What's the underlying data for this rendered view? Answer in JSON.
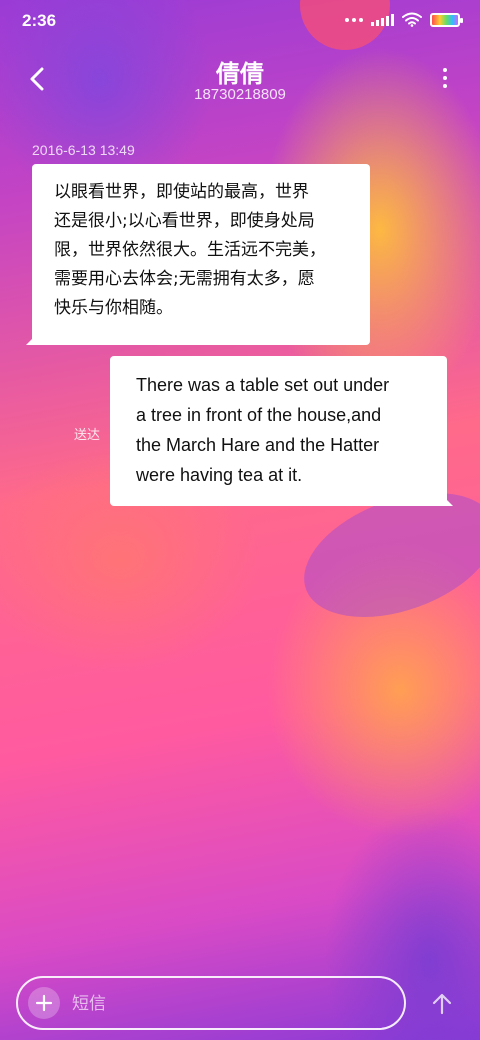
{
  "status_bar": {
    "time": "2:36"
  },
  "header": {
    "contact_name": "倩倩",
    "contact_number": "18730218809"
  },
  "conversation": {
    "timestamp": "2016-6-13 13:49",
    "messages": [
      {
        "direction": "incoming",
        "lines": [
          "以眼看世界，即使站的最高，世界",
          "还是很小;以心看世界，即使身处局",
          "限，世界依然很大。生活远不完美，",
          "需要用心去体会;无需拥有太多，愿",
          "快乐与你相随。"
        ]
      },
      {
        "direction": "outgoing",
        "lines": [
          "There was a table set out under",
          "a tree in front of the house,and",
          "the March Hare and the Hatter",
          "were having tea at it."
        ],
        "status": "送达"
      }
    ]
  },
  "composer": {
    "placeholder": "短信"
  },
  "icons": {
    "back": "chevron-left-icon",
    "more": "more-vertical-icon",
    "add": "plus-icon",
    "send": "arrow-up-icon",
    "wifi": "wifi-icon",
    "signal": "signal-icon",
    "battery": "battery-icon"
  },
  "colors": {
    "bubble_background": "#ffffff",
    "text_on_background": "#ffffff"
  }
}
